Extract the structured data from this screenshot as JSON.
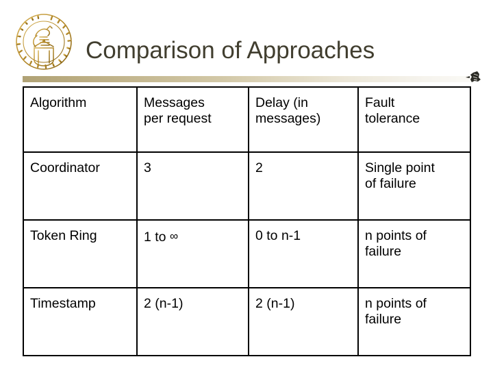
{
  "slide": {
    "title": "Comparison of Approaches",
    "title_color": "#413e2f",
    "logo_name": "purdue-university-seal",
    "divider_gradient_from": "#b0a275",
    "divider_gradient_to": "#faf9f5",
    "ornament_color": "#2b2b25"
  },
  "table": {
    "headers": [
      {
        "line1": "Algorithm",
        "line2": ""
      },
      {
        "line1": "Messages",
        "line2": "per request"
      },
      {
        "line1": "Delay (in",
        "line2": "messages)"
      },
      {
        "line1": "Fault",
        "line2": "tolerance"
      }
    ],
    "rows": [
      {
        "algorithm": "Coordinator",
        "messages": "3",
        "delay": "2",
        "fault_line1": "Single point",
        "fault_line2": "of failure"
      },
      {
        "algorithm": "Token Ring",
        "messages_prefix": "1 to ",
        "messages_symbol": "∞",
        "delay": "0 to n-1",
        "fault_line1": "n points of",
        "fault_line2": "failure"
      },
      {
        "algorithm": "Timestamp",
        "messages": "2 (n-1)",
        "delay": "2 (n-1)",
        "fault_line1": "n points of",
        "fault_line2": "failure"
      }
    ]
  }
}
